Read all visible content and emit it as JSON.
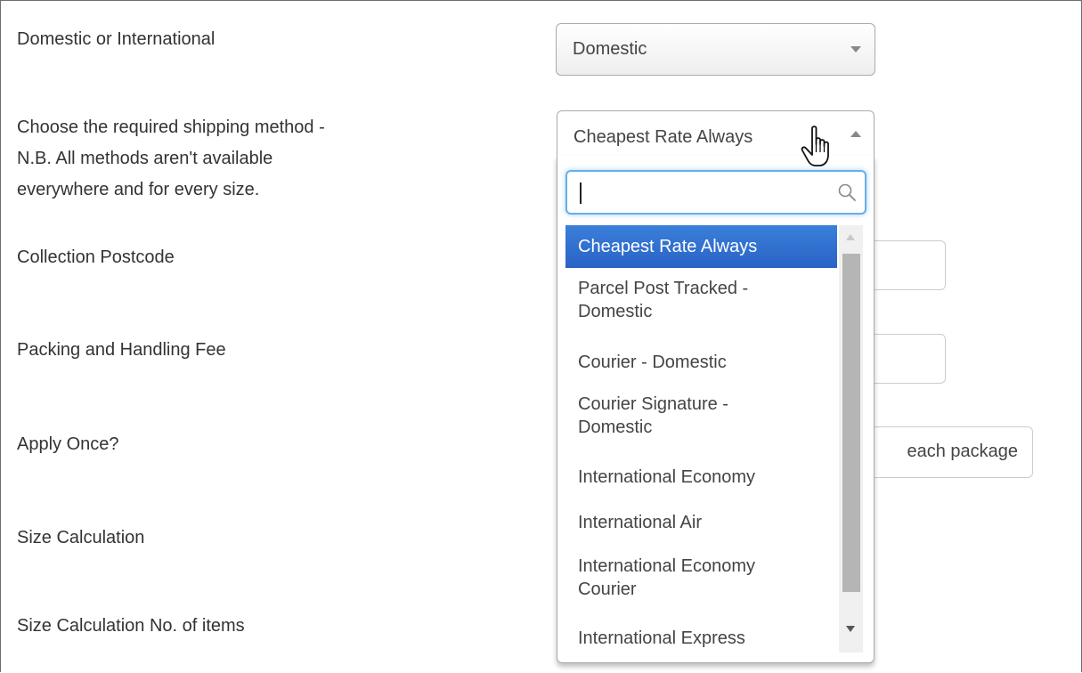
{
  "form": {
    "labels": {
      "domestic_or_international": "Domestic or International",
      "shipping_method_line1": "Choose the required shipping method -",
      "shipping_method_line2": "N.B. All methods aren't available",
      "shipping_method_line3": "everywhere and for every size.",
      "collection_postcode": "Collection Postcode",
      "packing_fee": "Packing and Handling Fee",
      "apply_once": "Apply Once?",
      "size_calculation": "Size Calculation",
      "size_calc_items": "Size Calculation No. of items"
    },
    "domestic_select": {
      "value": "Domestic"
    },
    "shipping_select": {
      "value": "Cheapest Rate Always"
    },
    "apply_once_select": {
      "value_visible_fragment": "each package"
    }
  },
  "dropdown": {
    "search_value": "",
    "options": [
      {
        "line1": "Cheapest Rate Always",
        "line2": "",
        "selected": true
      },
      {
        "line1": "Parcel Post Tracked -",
        "line2": "Domestic",
        "selected": false
      },
      {
        "line1": "Courier - Domestic",
        "line2": "",
        "selected": false
      },
      {
        "line1": "Courier Signature -",
        "line2": "Domestic",
        "selected": false
      },
      {
        "line1": "International Economy",
        "line2": "",
        "selected": false
      },
      {
        "line1": "International Air",
        "line2": "",
        "selected": false
      },
      {
        "line1": "International Economy",
        "line2": "Courier",
        "selected": false
      },
      {
        "line1": "International Express",
        "line2": "",
        "selected": false
      }
    ]
  },
  "colors": {
    "selected_option": "#2a63c6",
    "focus_ring": "#66afe9"
  },
  "icons": {
    "search": "search-icon",
    "cursor": "hand-pointer-icon"
  }
}
